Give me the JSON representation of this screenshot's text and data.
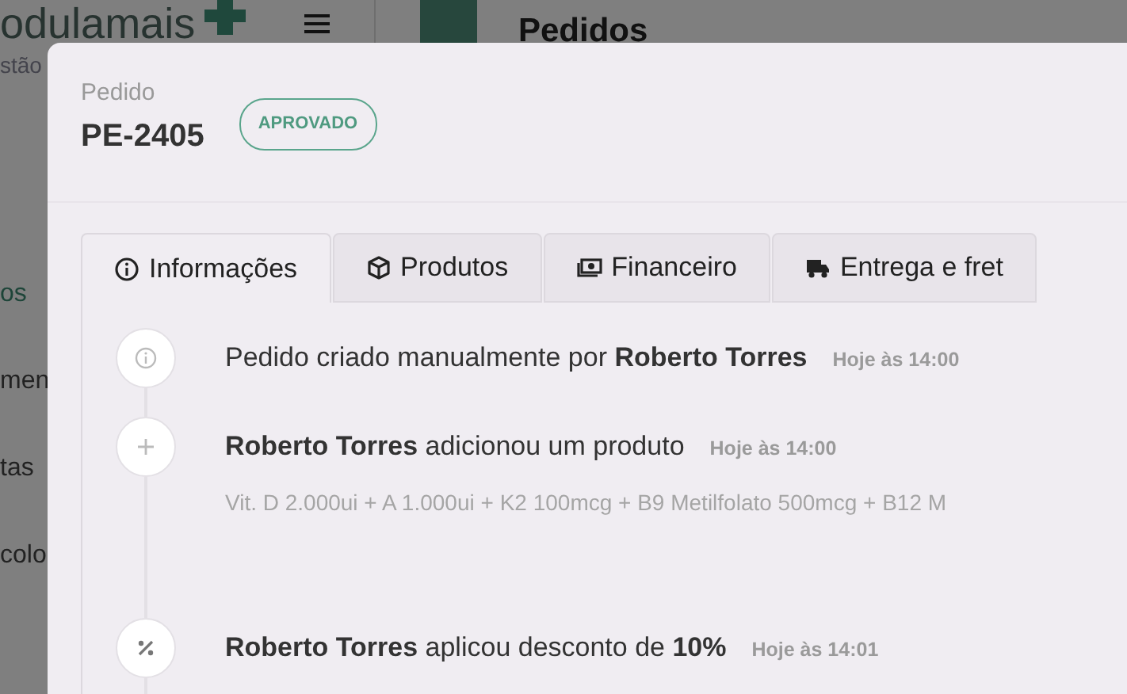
{
  "background": {
    "logo": "odulamais",
    "logo_subtitle": "stão",
    "page_title": "Pedidos",
    "sidebar": [
      {
        "label": "os",
        "kind": "item",
        "selected": true
      },
      {
        "label": "men",
        "kind": "item",
        "selected": false
      },
      {
        "label": "tas",
        "kind": "item",
        "selected": false
      },
      {
        "label": "colo",
        "kind": "item",
        "selected": false
      }
    ]
  },
  "modal": {
    "label": "Pedido",
    "code": "PE-2405",
    "status": "APROVADO",
    "tabs": [
      {
        "label": "Informações",
        "kind": "info",
        "selected": true
      },
      {
        "label": "Produtos",
        "kind": "box",
        "selected": false
      },
      {
        "label": "Financeiro",
        "kind": "money",
        "selected": false
      },
      {
        "label": "Entrega e fret",
        "kind": "truck",
        "selected": false
      }
    ],
    "events": [
      {
        "kind": "info",
        "text": "Pedido criado manualmente por **Roberto Torres**",
        "time": "Hoje às 14:00"
      },
      {
        "kind": "add",
        "text": "**Roberto Torres** adicionou um produto",
        "time": "Hoje às 14:00",
        "detail": "Vit. D 2.000ui + A 1.000ui + K2 100mcg + B9 Metilfolato 500mcg + B12 M"
      },
      {
        "kind": "discount",
        "text": "**Roberto Torres** aplicou desconto de **10%**",
        "time": "Hoje às 14:01"
      }
    ]
  }
}
